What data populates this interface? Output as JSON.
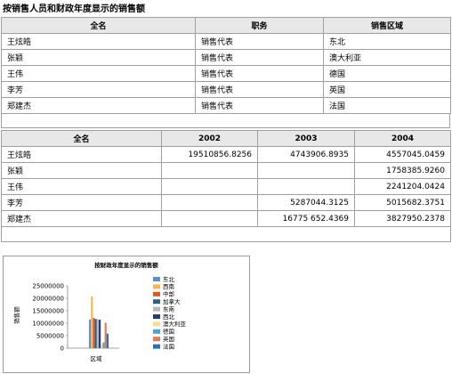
{
  "report": {
    "title": "按销售人员和财政年度显示的销售额"
  },
  "table1": {
    "headers": [
      "全名",
      "职务",
      "销售区域"
    ],
    "rows": [
      [
        "王炫皓",
        "销售代表",
        "东北"
      ],
      [
        "张颖",
        "销售代表",
        "澳大利亚"
      ],
      [
        "王伟",
        "销售代表",
        "德国"
      ],
      [
        "李芳",
        "销售代表",
        "英国"
      ],
      [
        "郑建杰",
        "销售代表",
        "法国"
      ]
    ]
  },
  "table2": {
    "headers": [
      "全名",
      "2002",
      "2003",
      "2004"
    ],
    "rows": [
      [
        "王炫皓",
        "19510856.8256",
        "4743906.8935",
        "4557045.0459"
      ],
      [
        "张颖",
        "",
        "",
        "1758385.9260"
      ],
      [
        "王伟",
        "",
        "",
        "2241204.0424"
      ],
      [
        "李芳",
        "",
        "5287044.3125",
        "5015682.3751"
      ],
      [
        "郑建杰",
        "",
        "16775 652.4369",
        "3827950.2378"
      ]
    ]
  },
  "chart_data": {
    "type": "bar",
    "title": "按财政年度显示的销售额",
    "xlabel": "区域",
    "ylabel": "销售额",
    "categories": [
      "区域"
    ],
    "ylim": [
      0,
      25000000
    ],
    "yticks": [
      "0",
      "5000000",
      "10000000",
      "15000000",
      "20000000",
      "25000000"
    ],
    "grid": false,
    "legend_position": "right",
    "series": [
      {
        "name": "东北",
        "color": "#5b8ed6",
        "values": [
          11500000
        ]
      },
      {
        "name": "西南",
        "color": "#f7b94a",
        "values": [
          20800000
        ]
      },
      {
        "name": "中部",
        "color": "#e0582a",
        "values": [
          12100000
        ]
      },
      {
        "name": "加拿大",
        "color": "#2b5f8a",
        "values": [
          11700000
        ]
      },
      {
        "name": "东南",
        "color": "#b8b8b8",
        "values": [
          11600000
        ]
      },
      {
        "name": "西北",
        "color": "#1f3f7a",
        "values": [
          11400000
        ]
      },
      {
        "name": "澳大利亚",
        "color": "#f4e08a",
        "values": [
          1500000
        ]
      },
      {
        "name": "德国",
        "color": "#54a0d8",
        "values": [
          2300000
        ]
      },
      {
        "name": "英国",
        "color": "#e87a4d",
        "values": [
          10200000
        ]
      },
      {
        "name": "法国",
        "color": "#2a6fb7",
        "values": [
          5800000
        ]
      }
    ]
  }
}
